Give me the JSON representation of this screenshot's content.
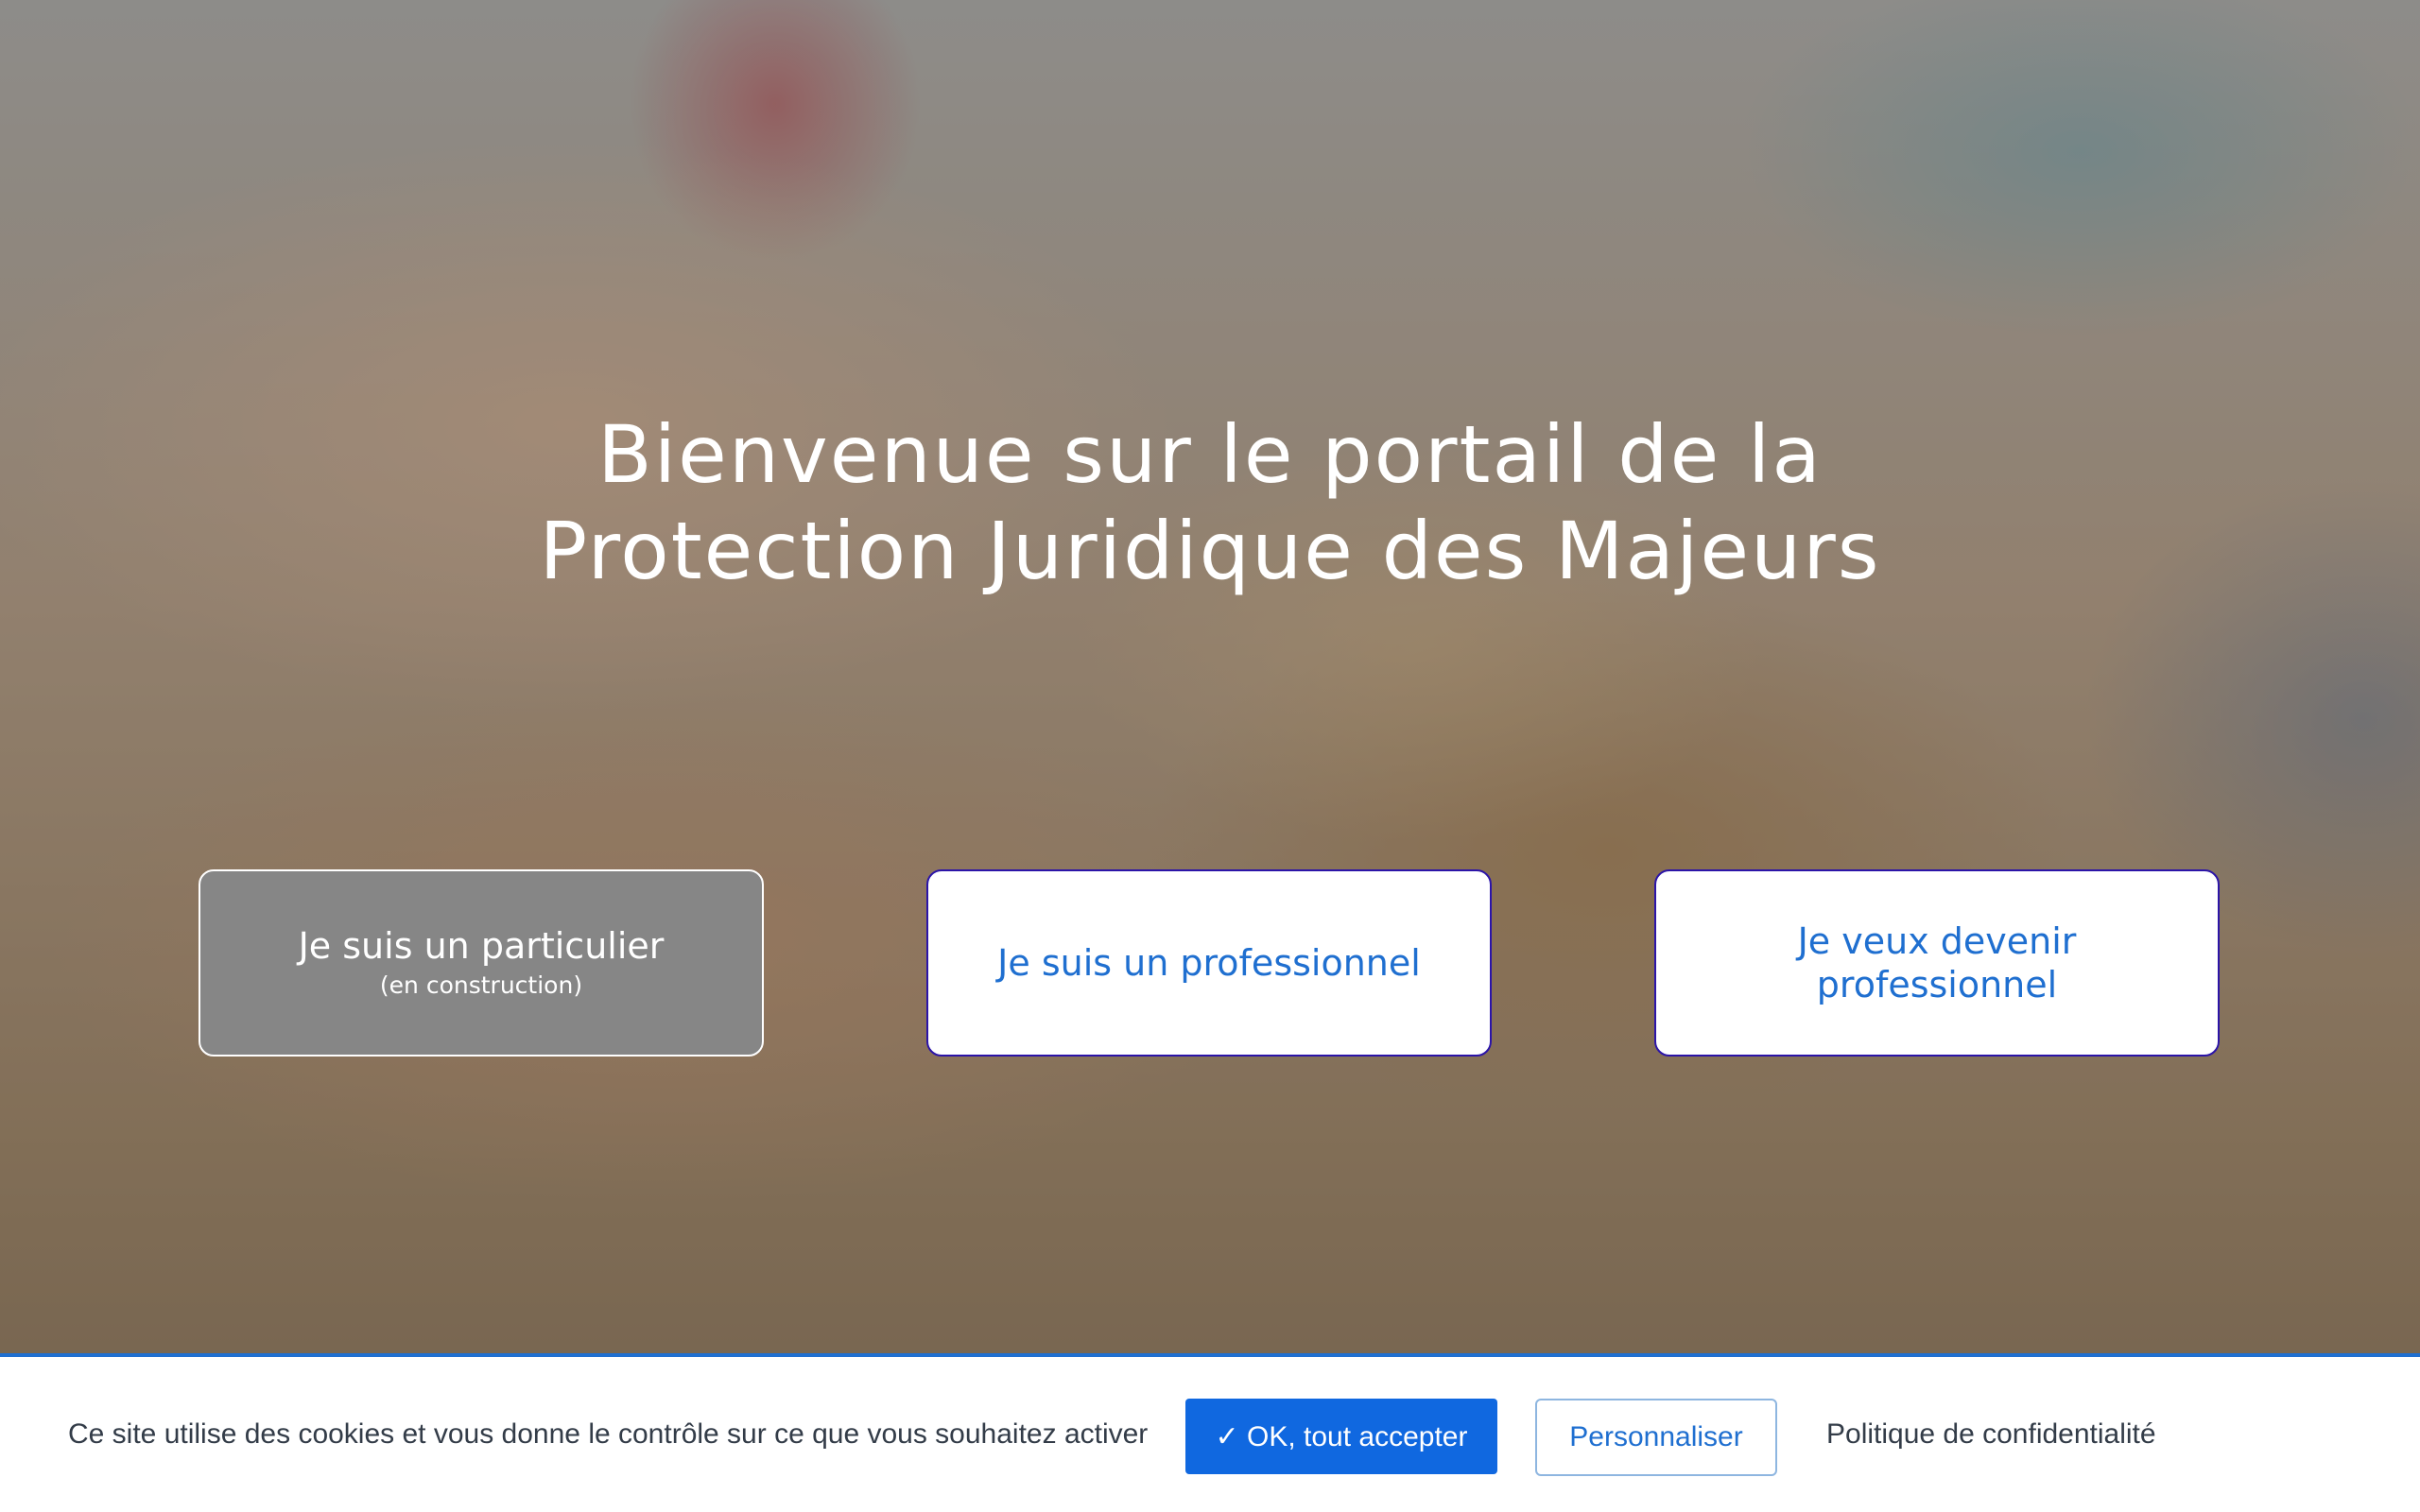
{
  "hero": {
    "title_line1": "Bienvenue sur le portail de la",
    "title_line2": "Protection Juridique des Majeurs"
  },
  "choices": [
    {
      "label": "Je suis un particulier",
      "sublabel": "(en construction)"
    },
    {
      "label": "Je suis un professionnel"
    },
    {
      "label": "Je veux devenir professionnel"
    }
  ],
  "cookie_banner": {
    "text": "Ce site utilise des cookies et vous donne le contrôle sur ce que vous souhaitez activer",
    "accept_label": "✓ OK, tout accepter",
    "customize_label": "Personnaliser",
    "privacy_label": "Politique de confidentialité"
  },
  "colors": {
    "accent": "#1068e0",
    "link_text": "#1f6fd0",
    "button_border": "#2b14a8",
    "disabled_button": "#868686"
  }
}
